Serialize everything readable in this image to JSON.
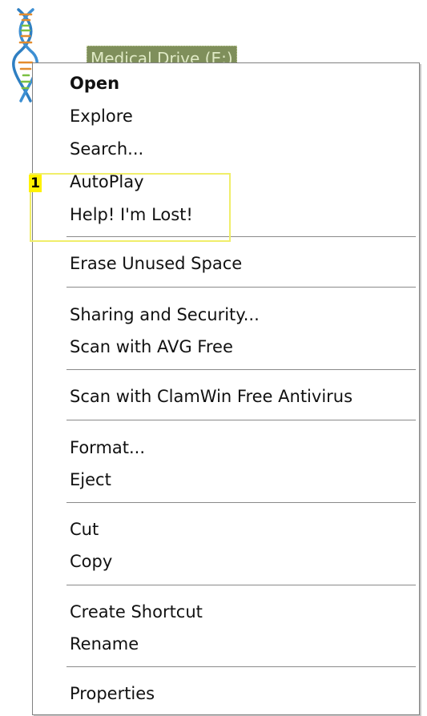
{
  "drive": {
    "label": "Medical Drive (E:)",
    "icon": "dna-helix-icon"
  },
  "annotation": {
    "number": "1",
    "color": "#fff200"
  },
  "menu": {
    "items": [
      {
        "label": "Open"
      },
      {
        "label": "Explore"
      },
      {
        "label": "Search..."
      },
      {
        "label": "AutoPlay"
      },
      {
        "label": "Help! I'm Lost!"
      },
      {
        "label": "Erase Unused Space"
      },
      {
        "label": "Sharing and Security..."
      },
      {
        "label": "Scan with AVG Free"
      },
      {
        "label": "Scan with ClamWin Free Antivirus"
      },
      {
        "label": "Format..."
      },
      {
        "label": "Eject"
      },
      {
        "label": "Cut"
      },
      {
        "label": "Copy"
      },
      {
        "label": "Create Shortcut"
      },
      {
        "label": "Rename"
      },
      {
        "label": "Properties"
      }
    ]
  }
}
